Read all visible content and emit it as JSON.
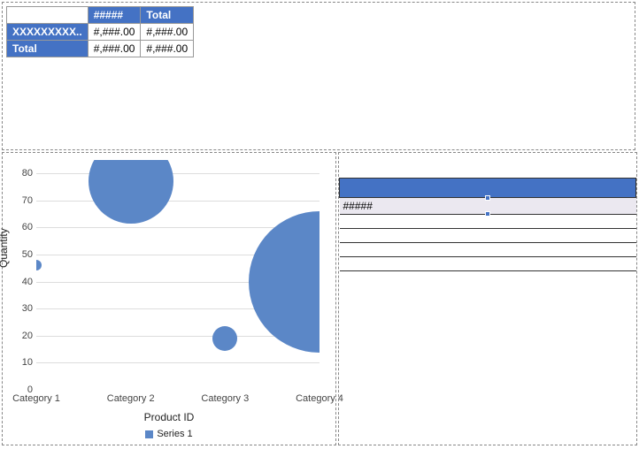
{
  "table": {
    "col1": "#####",
    "col2": "Total",
    "row_label": "XXXXXXXXX..",
    "row_v1": "#,###.00",
    "row_v2": "#,###.00",
    "total_label": "Total",
    "total_v1": "#,###.00",
    "total_v2": "#,###.00"
  },
  "right_table": {
    "value": "#####"
  },
  "chart_data": {
    "type": "bubble",
    "title": "",
    "xlabel": "Product ID",
    "ylabel": "Quantity",
    "ylim": [
      0,
      85
    ],
    "ytick_step": 10,
    "categories": [
      "Category 1",
      "Category 2",
      "Category 3",
      "Category 4"
    ],
    "series": [
      {
        "name": "Series 1",
        "values": [
          46,
          77,
          19,
          40
        ],
        "sizes": [
          6,
          48,
          14,
          80
        ]
      }
    ],
    "color": "#5B87C7"
  }
}
